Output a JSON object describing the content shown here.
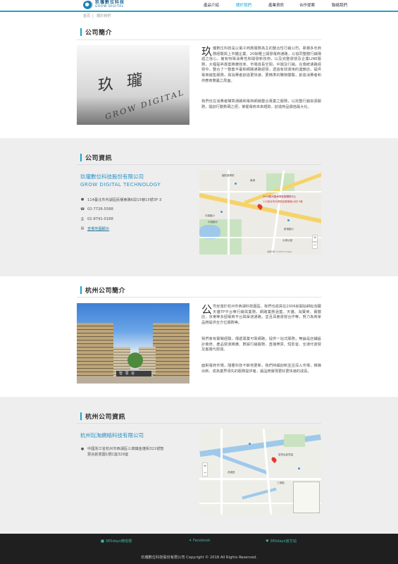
{
  "brand": {
    "name_cn": "玖瓏數位科技",
    "name_en": "GROW DIGITAL"
  },
  "nav": [
    "產品介紹",
    "關於我們",
    "產業資訊",
    "合作提案",
    "聯絡我們"
  ],
  "breadcrumb": [
    "首頁",
    "關於我們"
  ],
  "sections": {
    "intro_title": "公司簡介",
    "info_title": "公司資訊",
    "hz_intro_title": "杭州公司簡介",
    "hz_info_title": "杭州公司資訊"
  },
  "intro": {
    "dropcap": "玖",
    "p1": "瓏數位科技是以電子商務服務為主的整合性行銷公司，累積多年商務經驗與上市櫃企業、20餘種上開發電商通路，以協同整體行銷傳遞之信心，擁有特殊消費性和開發新技術，以及完整運營及企業LINE服務，大幅提昇專案推廣效率、市場成長空間，中端及行銷。在傳統通路經營中，整合了一整套平臺和網路通路經營，透過有效運用的連鎖店，提供電商銷售服務，與消費者創造更快速、更精準的購物體驗，創造消費者和供應商雙贏之局面。",
    "p2": "我們也在消費者購買通路和電商網絡整合專業之服務，以完整行銷資源服務，開創行動數碼之便，掌握電商未來趨勢，創造商品價值最大化。"
  },
  "company": {
    "name_cn": "玖瓏數位科技股份有限公司",
    "name_en": "GROW DIGITAL TECHNOLOGY",
    "address": "114臺北市內湖區民權東路6段15巷15號3F-3",
    "phone": "02-7726-5588",
    "fax": "02-8791-0188",
    "map_link": "查看地圖顯示"
  },
  "map1": {
    "labels": [
      "國防醫學院",
      "東湖",
      "內湖國小",
      "內湖國中",
      "新湖國小",
      "大湖公園",
      "2018舊宗路休閒家庭購物中心"
    ],
    "pin_label": "114臺北市內湖區民權東路六段15巷",
    "attribution": "地圖資料 ©2018 Google"
  },
  "hz_intro": {
    "dropcap": "公",
    "p1": "司坐落於杭州市西湖科技園區，我們也成員在2006就開始耕耘淘寶天貓TP平台等行銷與業務，網路業務涵蓋，天貓、淘寶商、實體店、京東等多個電商平台與渠道通路，並且深度運營合作等，努力為商家品牌提供全方位服務等。",
    "p2": "我們會有實戰經驗，傳遞專業可靠網路，提供一站式服務；無論是店鋪設計裝修、產品營運推廣、數據行銷服務、直播帶貨、短影音、全通代運營及客服代營運。",
    "p3": "面對電商市場，隨著科技不斷地更新，我們持續創新並且深入市場，推陳出新，成為業界領先的服務提供者，讓品牌實現更好更快速的成長。"
  },
  "hz_company": {
    "name_cn": "杭州玩淘網絡科技有限公司",
    "address": "中國浙江省杭州市西湖區三墩鎮金蓬街321號智慧谷創意園1號C座329室"
  },
  "map2": {
    "labels": [
      "西湖區",
      "三墩鎮",
      "智慧谷創意園"
    ]
  },
  "footer": {
    "links": [
      "365days微信號",
      "Facebook",
      "365days官方站"
    ],
    "copyright": "玖瓏數位科技股份有限公司 Copyright © 2018 All Rights Reserved."
  }
}
